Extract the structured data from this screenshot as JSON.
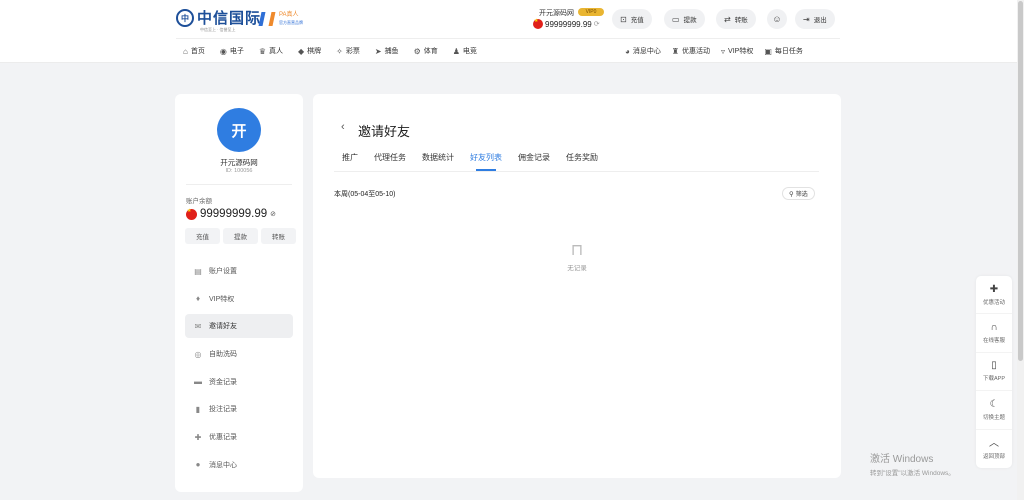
{
  "header": {
    "logo_text": "中信国际",
    "logo_sub": "中信至上 · 信誉至上",
    "pa_title": "PA真人",
    "pa_sub": "官方直营品牌",
    "username": "开元源码网",
    "vip_badge": "VIP0",
    "balance": "99999999.99",
    "buttons": [
      {
        "label": "充值",
        "icon": "wallet-icon"
      },
      {
        "label": "提款",
        "icon": "card-icon"
      },
      {
        "label": "转账",
        "icon": "transfer-icon"
      },
      {
        "label": "退出",
        "icon": "logout-icon"
      }
    ]
  },
  "nav": {
    "left": [
      "首页",
      "电子",
      "真人",
      "棋牌",
      "彩票",
      "捕鱼",
      "体育",
      "电竞"
    ],
    "right": [
      "消息中心",
      "优惠活动",
      "VIP特权",
      "每日任务"
    ]
  },
  "sidebar": {
    "avatar_char": "开",
    "name": "开元源码网",
    "id": "ID: 100056",
    "balance_label": "账户余额",
    "balance": "99999999.99",
    "buttons": [
      "充值",
      "提款",
      "转账"
    ],
    "menu": [
      "账户设置",
      "VIP特权",
      "邀请好友",
      "自助洗码",
      "资金记录",
      "投注记录",
      "优惠记录",
      "消息中心"
    ]
  },
  "main": {
    "title": "邀请好友",
    "tabs": [
      "推广",
      "代理任务",
      "数据统计",
      "好友列表",
      "佣金记录",
      "任务奖励"
    ],
    "active_tab": "好友列表",
    "week_label": "本周(05-04至05-10)",
    "filter_label": "筛选",
    "empty_text": "无记录"
  },
  "float_bar": [
    "优惠活动",
    "在线客服",
    "下载APP",
    "切换主题",
    "返回顶部"
  ],
  "watermark": {
    "line1": "激活 Windows",
    "line2": "转到\"设置\"以激活 Windows。"
  },
  "colors": {
    "accent": "#2f7de1",
    "vip": "#e9b531"
  }
}
